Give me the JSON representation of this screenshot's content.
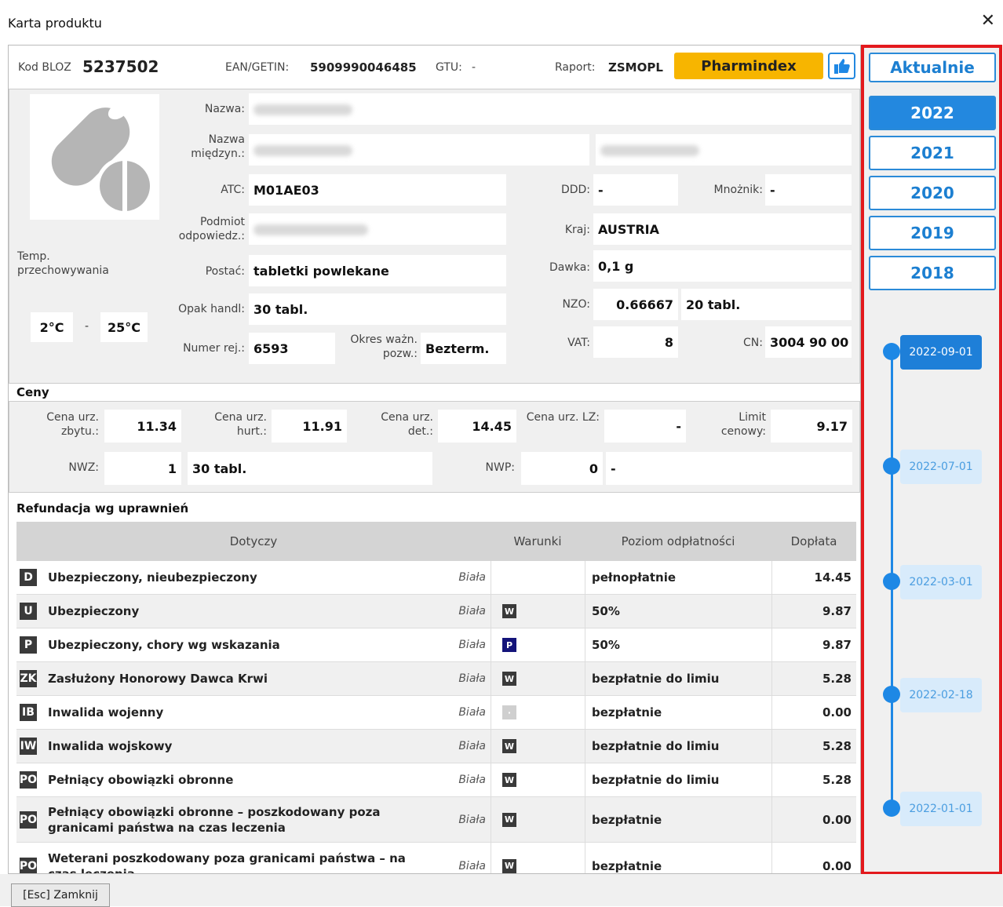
{
  "window": {
    "title": "Karta produktu",
    "close_glyph": "✕"
  },
  "header": {
    "bloz_label": "Kod BLOZ",
    "bloz_value": "5237502",
    "ean_label": "EAN/GETIN:",
    "ean_value": "5909990046485",
    "gtu_label": "GTU:",
    "gtu_value": "-",
    "raport_label": "Raport:",
    "raport_value": "ZSMOPL",
    "pharmindex_label": "Pharmindex",
    "like_icon": "thumbs-up-icon"
  },
  "product": {
    "temp_label": "Temp. przechowywania",
    "temp_min": "2°C",
    "temp_sep": "-",
    "temp_max": "25°C",
    "nazwa_label": "Nazwa:",
    "nazwa_miedzyn_label": "Nazwa międzyn.:",
    "atc_label": "ATC:",
    "atc_value": "M01AE03",
    "ddd_label": "DDD:",
    "ddd_value": "-",
    "mnoznik_label": "Mnożnik:",
    "mnoznik_value": "-",
    "podmiot_label": "Podmiot odpowiedz.:",
    "kraj_label": "Kraj:",
    "kraj_value": "AUSTRIA",
    "postac_label": "Postać:",
    "postac_value": "tabletki powlekane",
    "dawka_label": "Dawka:",
    "dawka_value": "0,1 g",
    "opak_label": "Opak handl:",
    "opak_value": "30 tabl.",
    "nzo_label": "NZO:",
    "nzo_value": "0.66667",
    "nzo_unit": "20 tabl.",
    "numer_label": "Numer rej.:",
    "numer_value": "6593",
    "okres_label": "Okres ważn. pozw.:",
    "okres_value": "Bezterm.",
    "vat_label": "VAT:",
    "vat_value": "8",
    "cn_label": "CN:",
    "cn_value": "3004 90 00"
  },
  "ceny": {
    "title": "Ceny",
    "cena_zbytu_label": "Cena urz. zbytu.:",
    "cena_zbytu": "11.34",
    "cena_hurt_label": "Cena urz. hurt.:",
    "cena_hurt": "11.91",
    "cena_det_label": "Cena urz. det.:",
    "cena_det": "14.45",
    "cena_lz_label": "Cena urz. LZ:",
    "cena_lz": "-",
    "limit_label": "Limit cenowy:",
    "limit": "9.17",
    "nwz_label": "NWZ:",
    "nwz": "1",
    "nwz_unit": "30 tabl.",
    "nwp_label": "NWP:",
    "nwp": "0",
    "nwp_unit": "-"
  },
  "refundacja": {
    "title": "Refundacja wg uprawnień",
    "headers": [
      "Dotyczy",
      "Warunki",
      "Poziom odpłatności",
      "Dopłata"
    ],
    "rows": [
      {
        "code": "D",
        "name": "Ubezpieczony, nieubezpieczony",
        "list": "Biała",
        "cond": "",
        "level": "pełnopłatnie",
        "doplata": "14.45"
      },
      {
        "code": "U",
        "name": "Ubezpieczony",
        "list": "Biała",
        "cond": "W",
        "level": "50%",
        "doplata": "9.87"
      },
      {
        "code": "P",
        "name": "Ubezpieczony, chory wg wskazania",
        "list": "Biała",
        "cond": "P",
        "level": "50%",
        "doplata": "9.87"
      },
      {
        "code": "ZK",
        "name": "Zasłużony Honorowy Dawca Krwi",
        "list": "Biała",
        "cond": "W",
        "level": "bezpłatnie do limiu",
        "doplata": "5.28"
      },
      {
        "code": "IB",
        "name": "Inwalida wojenny",
        "list": "Biała",
        "cond": "·",
        "level": "bezpłatnie",
        "doplata": "0.00"
      },
      {
        "code": "IW",
        "name": "Inwalida wojskowy",
        "list": "Biała",
        "cond": "W",
        "level": "bezpłatnie do limiu",
        "doplata": "5.28"
      },
      {
        "code": "PO",
        "name": "Pełniący obowiązki obronne",
        "list": "Biała",
        "cond": "W",
        "level": "bezpłatnie do limiu",
        "doplata": "5.28"
      },
      {
        "code": "PO",
        "name": "Pełniący obowiązki obronne – poszkodowany poza granicami państwa na czas leczenia",
        "list": "Biała",
        "cond": "W",
        "level": "bezpłatnie",
        "doplata": "0.00"
      },
      {
        "code": "PO",
        "name": "Weterani poszkodowany poza granicami państwa – na czas leczenia",
        "list": "Biała",
        "cond": "W",
        "level": "bezpłatnie",
        "doplata": "0.00"
      }
    ]
  },
  "right": {
    "current": "Aktualnie",
    "years": [
      "2022",
      "2021",
      "2020",
      "2019",
      "2018"
    ],
    "dates": [
      "2022-09-01",
      "2022-07-01",
      "2022-03-01",
      "2022-02-18",
      "2022-01-01"
    ]
  },
  "footer": {
    "esc_label": "[Esc] Zamknij"
  },
  "colors": {
    "accent": "#1e88e5",
    "pharmindex": "#f7b500",
    "highlight": "#e3191d"
  }
}
